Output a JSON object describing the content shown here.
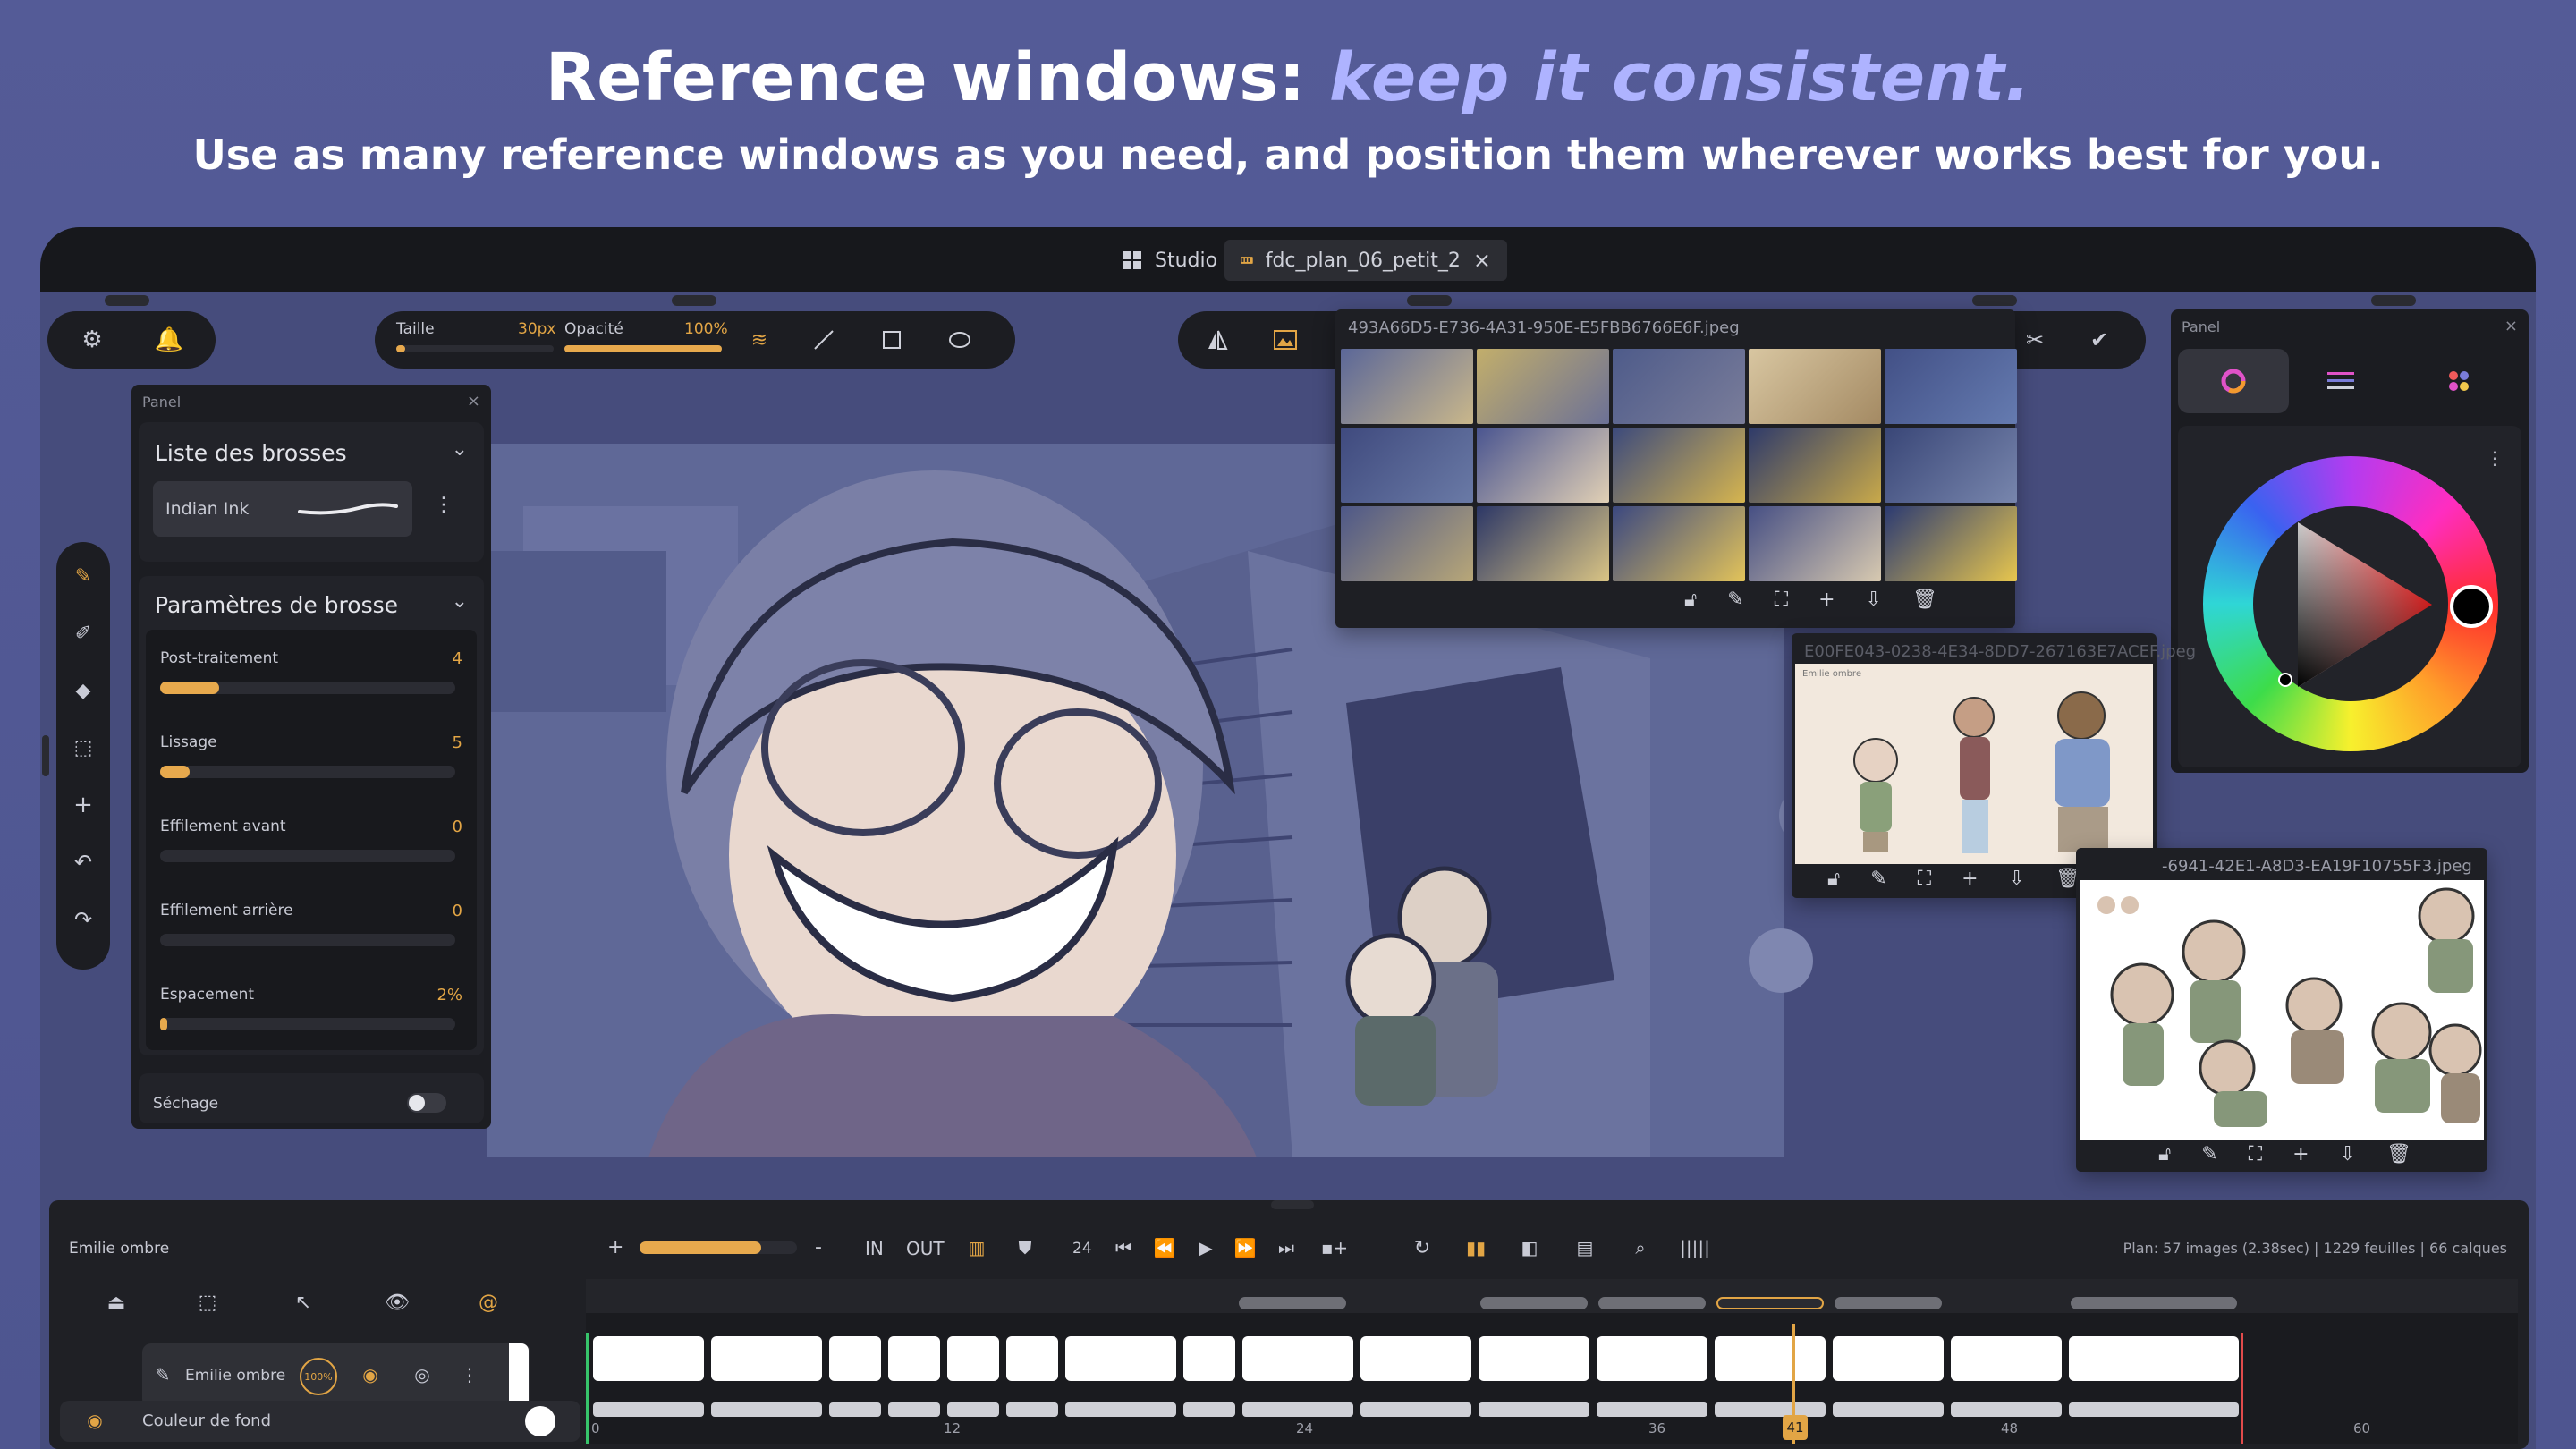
{
  "headline": {
    "main": "Reference windows: ",
    "accent": "keep it consistent."
  },
  "subheadline": "Use as many reference windows as you need, and position them wherever works best for you.",
  "tabs": [
    {
      "label": "Studio",
      "icon": "grid-icon"
    },
    {
      "label": "fdc_plan_06_petit_2",
      "icon": "film-icon",
      "close": "×"
    }
  ],
  "brush_toolbar": {
    "size_label": "Taille",
    "size_value": "30px",
    "size_fraction": 0.05,
    "opacity_label": "Opacité",
    "opacity_value": "100%",
    "opacity_fraction": 1.0
  },
  "brush_panel": {
    "panel_label": "Panel",
    "close": "×",
    "brush_list_title": "Liste des brosses",
    "current_brush": "Indian Ink",
    "params_title": "Paramètres de brosse",
    "params": [
      {
        "label": "Post-traitement",
        "value": "4",
        "fraction": 0.2
      },
      {
        "label": "Lissage",
        "value": "5",
        "fraction": 0.1
      },
      {
        "label": "Effilement avant",
        "value": "0",
        "fraction": 0.0
      },
      {
        "label": "Effilement arrière",
        "value": "0",
        "fraction": 0.0
      },
      {
        "label": "Espacement",
        "value": "2%",
        "fraction": 0.02
      }
    ],
    "drying_label": "Séchage"
  },
  "color_panel": {
    "panel_label": "Panel",
    "close": "×",
    "menu": "⋮"
  },
  "reference_windows": [
    {
      "title": "493A66D5-E736-4A31-950E-E5FBB6766E6F.jpeg"
    },
    {
      "title": "E00FE043-0238-4E34-8DD7-267163E7ACEF.jpeg",
      "sheet_label": "Emilie ombre"
    },
    {
      "title": "-6941-42E1-A8D3-EA19F10755F3.jpeg"
    }
  ],
  "timeline": {
    "layer_title": "Emilie ombre",
    "layers": [
      {
        "name": "Emilie ombre",
        "opacity": "100%"
      }
    ],
    "background_layer": "Couleur de fond",
    "in_label": "IN",
    "out_label": "OUT",
    "fps": "24",
    "plus": "+",
    "minus": "-",
    "plan_info": "Plan: 57 images (2.38sec) | 1229 feuilles | 66 calques",
    "ticks": [
      "0",
      "12",
      "24",
      "36",
      "48",
      "60"
    ],
    "current_frame": "41"
  }
}
